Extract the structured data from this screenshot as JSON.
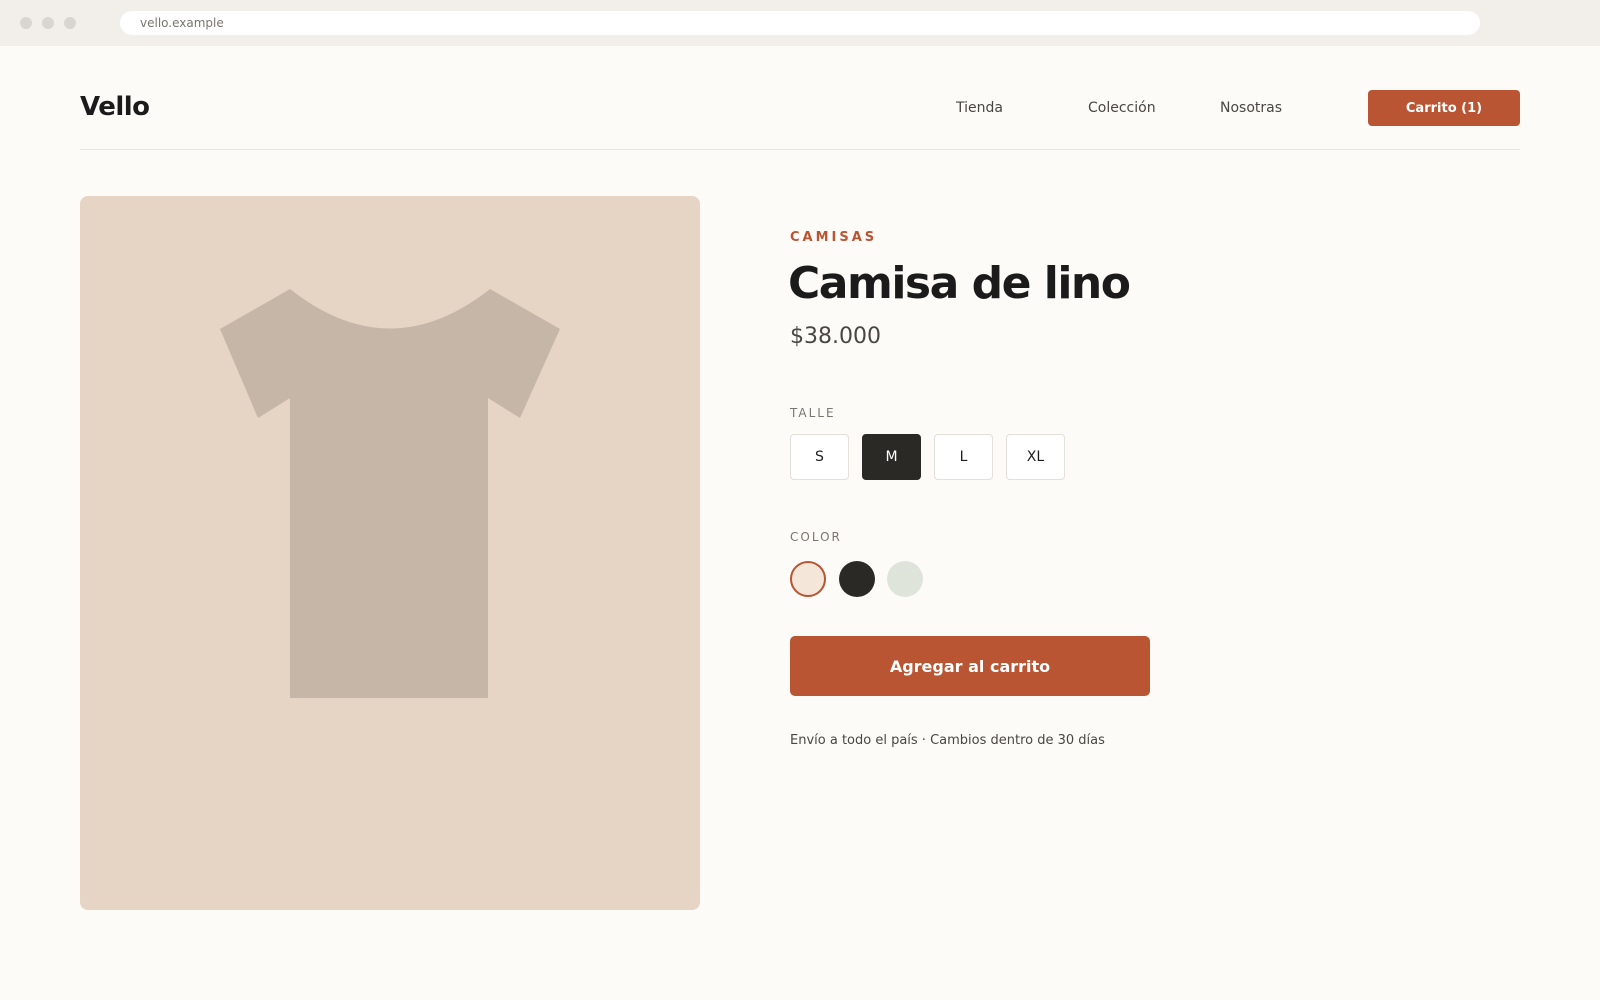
{
  "browser": {
    "url": "vello.example"
  },
  "header": {
    "logo": "Vello",
    "nav": [
      {
        "label": "Tienda"
      },
      {
        "label": "Colección"
      },
      {
        "label": "Nosotras"
      }
    ],
    "cart_label": "Carrito (1)"
  },
  "product": {
    "category": "CAMISAS",
    "title": "Camisa de lino",
    "price": "$38.000",
    "image_icon": "tshirt-icon",
    "size_label": "TALLE",
    "sizes": [
      "S",
      "M",
      "L",
      "XL"
    ],
    "selected_size": "M",
    "color_label": "COLOR",
    "colors": [
      "#f4e6d8",
      "#2a2925",
      "#dfe4db"
    ],
    "selected_color": 0,
    "add_to_cart_label": "Agregar al carrito",
    "shipping_note": "Envío a todo el país · Cambios dentro de 30 días"
  },
  "colors": {
    "accent": "#b95532",
    "image_bg": "#e6d4c5",
    "shirt": "#c6b6a7",
    "dark": "#2a2925"
  }
}
